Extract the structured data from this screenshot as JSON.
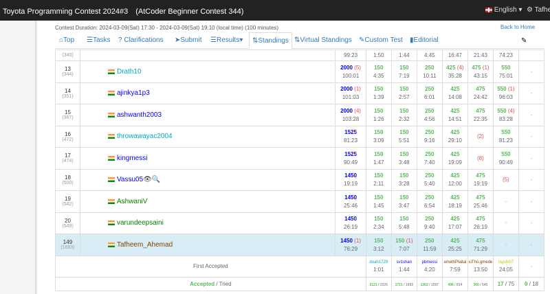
{
  "header": {
    "contest_title": "Toyota Programming Contest 2024#3　(AtCoder Beginner Contest 344)",
    "language": "English",
    "user": "Tafheem"
  },
  "contest": {
    "duration": "Contest Duration: 2024-03-09(Sat) 17:30 - 2024-03-09(Sat) 19:10 (local time) (100 minutes)",
    "back_home": "Back to Home"
  },
  "tabs": [
    {
      "label": "Top",
      "icon": "home-icon"
    },
    {
      "label": "Tasks",
      "icon": "list-icon"
    },
    {
      "label": "Clarifications",
      "icon": "question-icon"
    },
    {
      "label": "Submit",
      "icon": "send-icon"
    },
    {
      "label": "Results",
      "icon": "list-icon"
    },
    {
      "label": "Standings",
      "icon": "sort-icon"
    },
    {
      "label": "Virtual Standings",
      "icon": "sort-icon"
    },
    {
      "label": "Custom Test",
      "icon": "wrench-icon"
    },
    {
      "label": "Editorial",
      "icon": "book-icon"
    }
  ],
  "partial_row": {
    "rank_sub": "(340)",
    "times": [
      "99:23",
      "1:50",
      "1:44",
      "4:45",
      "16:47",
      "21:43",
      "74:23"
    ]
  },
  "rows": [
    {
      "rank": "13",
      "sub": "(344)",
      "name": "Drath10",
      "color": "cyan",
      "score": "2000",
      "pen": "(5)",
      "total_time": "100:01",
      "cells": [
        [
          "150",
          "4:35"
        ],
        [
          "150",
          "7:19"
        ],
        [
          "250",
          "10:11"
        ],
        [
          "425",
          "(4)",
          "35:28"
        ],
        [
          "475",
          "(1)",
          "43:15"
        ],
        [
          "550",
          "75:01"
        ],
        [
          "-"
        ]
      ]
    },
    {
      "rank": "14",
      "sub": "(351)",
      "name": "ajinkya1p3",
      "color": "blue",
      "score": "2000",
      "pen": "(1)",
      "total_time": "101:03",
      "cells": [
        [
          "150",
          "1:39"
        ],
        [
          "150",
          "2:57"
        ],
        [
          "250",
          "6:01"
        ],
        [
          "425",
          "14:08"
        ],
        [
          "475",
          "24:42"
        ],
        [
          "550",
          "(1)",
          "96:03"
        ],
        [
          "-"
        ]
      ]
    },
    {
      "rank": "15",
      "sub": "(367)",
      "name": "ashwanth2003",
      "color": "blue",
      "score": "2000",
      "pen": "(4)",
      "total_time": "103:28",
      "cells": [
        [
          "150",
          "1:26"
        ],
        [
          "150",
          "2:32"
        ],
        [
          "250",
          "4:56"
        ],
        [
          "425",
          "14:51"
        ],
        [
          "475",
          "22:35"
        ],
        [
          "550",
          "(4)",
          "83:28"
        ],
        [
          "-"
        ]
      ]
    },
    {
      "rank": "16",
      "sub": "(472)",
      "name": "throwawayac2004",
      "color": "cyan",
      "score": "1525",
      "pen": "",
      "total_time": "81:23",
      "cells": [
        [
          "150",
          "3:09"
        ],
        [
          "150",
          "5:51"
        ],
        [
          "250",
          "9:16"
        ],
        [
          "425",
          "29:10"
        ],
        [
          "(2)"
        ],
        [
          "550",
          "81:23"
        ],
        [
          "-"
        ]
      ]
    },
    {
      "rank": "17",
      "sub": "(474)",
      "name": "kingmessi",
      "color": "blue",
      "score": "1525",
      "pen": "",
      "total_time": "90:49",
      "cells": [
        [
          "150",
          "1:47"
        ],
        [
          "150",
          "3:48"
        ],
        [
          "250",
          "7:40"
        ],
        [
          "425",
          "19:09"
        ],
        [
          "(8)"
        ],
        [
          "550",
          "90:49"
        ],
        [
          "-"
        ]
      ]
    },
    {
      "rank": "18",
      "sub": "(500)",
      "name": "Vassu05",
      "color": "blue",
      "score": "1450",
      "pen": "",
      "total_time": "19:19",
      "cells": [
        [
          "150",
          "2:11"
        ],
        [
          "150",
          "3:28"
        ],
        [
          "250",
          "5:40"
        ],
        [
          "425",
          "12:00"
        ],
        [
          "475",
          "19:19"
        ],
        [
          "(5)"
        ],
        [
          "-"
        ]
      ]
    },
    {
      "rank": "19",
      "sub": "(542)",
      "name": "AshwaniV",
      "color": "green",
      "score": "1450",
      "pen": "",
      "total_time": "25:46",
      "cells": [
        [
          "150",
          "1:45"
        ],
        [
          "150",
          "3:47"
        ],
        [
          "250",
          "6:54"
        ],
        [
          "425",
          "18:19"
        ],
        [
          "475",
          "25:46"
        ],
        [
          "-"
        ],
        [
          "-"
        ]
      ]
    },
    {
      "rank": "20",
      "sub": "(549)",
      "name": "varundeepsaini",
      "color": "green",
      "score": "1450",
      "pen": "",
      "total_time": "26:19",
      "cells": [
        [
          "150",
          "2:34"
        ],
        [
          "150",
          "5:48"
        ],
        [
          "250",
          "9:40"
        ],
        [
          "425",
          "17:07"
        ],
        [
          "475",
          "26:19"
        ],
        [
          "-"
        ],
        [
          "-"
        ]
      ]
    },
    {
      "rank": "149",
      "sub": "(1693)",
      "name": "Tafheem_Ahemad",
      "color": "brown",
      "score": "1450",
      "pen": "(1)",
      "total_time": "76:29",
      "cells": [
        [
          "150",
          "3:12"
        ],
        [
          "150",
          "(1)",
          "7:07"
        ],
        [
          "250",
          "11:59"
        ],
        [
          "425",
          "25:25"
        ],
        [
          "475",
          "71:29"
        ],
        [
          "-"
        ],
        [
          "-"
        ]
      ]
    }
  ],
  "first_accepted": {
    "label": "First Accepted",
    "entries": [
      {
        "name": "doah1729",
        "time": "1:01",
        "color": "#00a9c0"
      },
      {
        "name": "sv1shan",
        "time": "1:44",
        "color": "#0000ff"
      },
      {
        "name": "pbmessi",
        "time": "4:20",
        "color": "#0000ff"
      },
      {
        "name": "amethPlaitai",
        "time": "7:59",
        "color": "#804000"
      },
      {
        "name": "ciTho.gmede",
        "time": "13:50",
        "color": "#804000"
      },
      {
        "name": "rayshi07",
        "time": "24:05",
        "color": "#c0c000"
      },
      {
        "name": "-",
        "time": ""
      }
    ]
  },
  "accepted_tried": {
    "label_a": "Accepted",
    "label_sep": " / Tried",
    "entries": [
      {
        "a": "2121",
        "t": "2226"
      },
      {
        "a": "1721",
        "t": "1993"
      },
      {
        "a": "1362",
        "t": "1597"
      },
      {
        "a": "496",
        "t": "814"
      },
      {
        "a": "360",
        "t": "545"
      },
      {
        "a": "17",
        "t": "75"
      },
      {
        "a": "0",
        "t": "18"
      }
    ]
  }
}
